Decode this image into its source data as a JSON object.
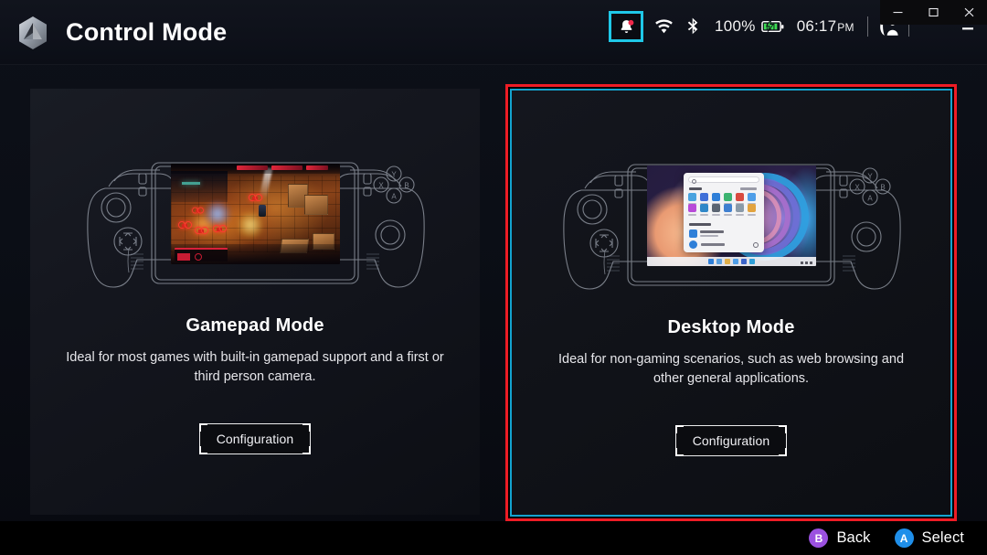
{
  "app": {
    "title": "Control Mode",
    "logo_icon": "hex-logo-icon"
  },
  "status_bar": {
    "notification": {
      "icon": "bell-icon",
      "badge": "unread-dot",
      "focused": true
    },
    "wifi": {
      "icon": "wifi-icon"
    },
    "bluetooth": {
      "icon": "bluetooth-icon"
    },
    "battery": {
      "percent": "100%",
      "icon": "battery-charging-icon",
      "color": "#3ddc52"
    },
    "clock": {
      "time": "06:17",
      "period": "PM"
    },
    "user": {
      "icon": "user-profile-icon"
    }
  },
  "window_controls": {
    "outer": {
      "minimize": "–",
      "maximize": "☐",
      "close": "✕"
    },
    "inner": {
      "minimize": "—",
      "collapse": "⌃"
    }
  },
  "cards": [
    {
      "id": "gamepad",
      "title": "Gamepad Mode",
      "description": "Ideal for most games with built-in gamepad support and a first or third person camera.",
      "button_label": "Configuration",
      "preview": "handheld-device-running-game",
      "selected": false
    },
    {
      "id": "desktop",
      "title": "Desktop Mode",
      "description": "Ideal for non-gaming scenarios, such as web browsing and other general applications.",
      "button_label": "Configuration",
      "preview": "handheld-device-running-windows-desktop",
      "selected": true
    }
  ],
  "selection": {
    "outer_border_color": "#ee1c25",
    "inner_border_color": "#13a3cf",
    "focus_color": "#1fc8e8"
  },
  "footer_hints": [
    {
      "button": "B",
      "label": "Back",
      "color": "#9b51e0"
    },
    {
      "button": "A",
      "label": "Select",
      "color": "#1f8fea"
    }
  ],
  "device_buttons": {
    "face": [
      "Y",
      "X",
      "B",
      "A"
    ]
  }
}
